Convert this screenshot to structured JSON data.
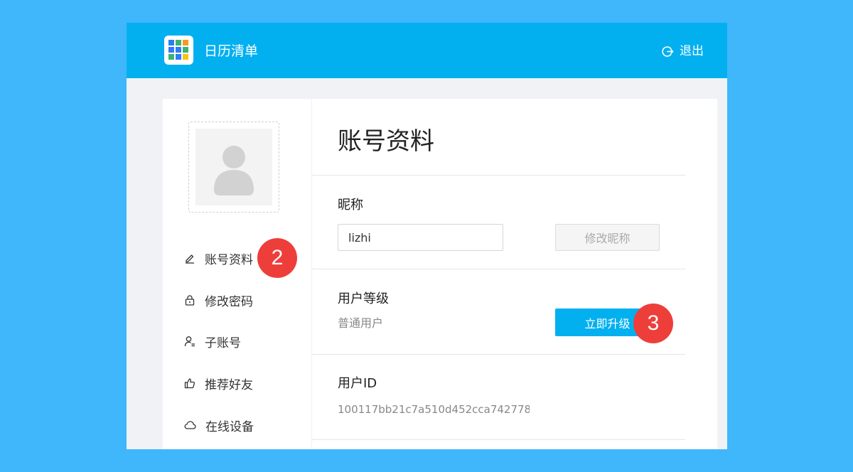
{
  "header": {
    "app_title": "日历清单",
    "logout_label": "退出",
    "logo_colors": [
      "#2f7cf6",
      "#3cb371",
      "#f59b23",
      "#2f7cf6",
      "#2f7cf6",
      "#3cb371",
      "#3cb371",
      "#2f7cf6",
      "#f5c518"
    ]
  },
  "sidebar": {
    "items": [
      {
        "label": "账号资料",
        "icon": "pencil-icon"
      },
      {
        "label": "修改密码",
        "icon": "lock-icon"
      },
      {
        "label": "子账号",
        "icon": "sub-account-icon"
      },
      {
        "label": "推荐好友",
        "icon": "thumbs-up-icon"
      },
      {
        "label": "在线设备",
        "icon": "cloud-icon"
      }
    ]
  },
  "main": {
    "title": "账号资料",
    "nickname": {
      "label": "昵称",
      "value": "lizhi",
      "button": "修改昵称"
    },
    "level": {
      "label": "用户等级",
      "value": "普通用户",
      "button": "立即升级"
    },
    "user_id": {
      "label": "用户ID",
      "value": "100117bb21c7a510d452cca742778"
    }
  },
  "annotations": {
    "step_2": "2",
    "step_3": "3",
    "color": "#ee3e3a"
  },
  "colors": {
    "accent": "#02b0f0",
    "background": "#40b6fb"
  }
}
